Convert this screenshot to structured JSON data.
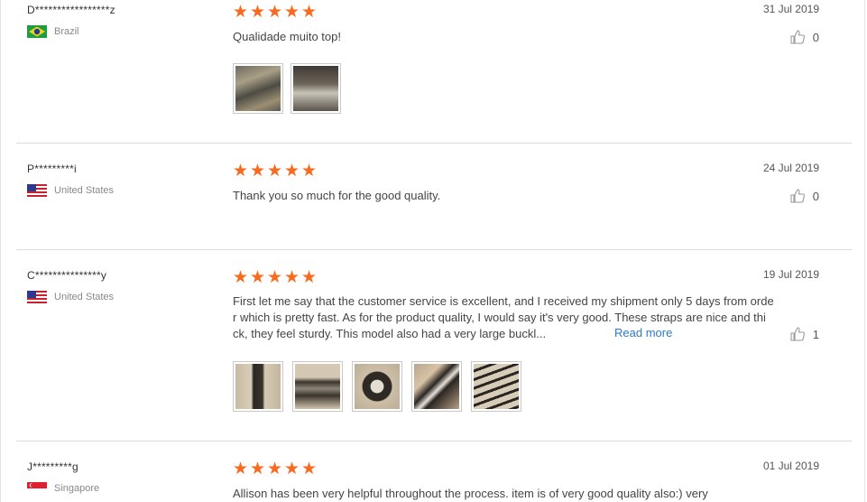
{
  "reviews": [
    {
      "name": "D*****************z",
      "country": "Brazil",
      "flag": "brazil-flag-icon",
      "rating": 5,
      "date": "31 Jul 2019",
      "text": "Qualidade muito top!",
      "likes": "0",
      "photos": 2
    },
    {
      "name": "P*********i",
      "country": "United States",
      "flag": "us-flag-icon",
      "rating": 5,
      "date": "24 Jul 2019",
      "text": "Thank you so much for the good quality.",
      "likes": "0",
      "photos": 0
    },
    {
      "name": "C***************y",
      "country": "United States",
      "flag": "us-flag-icon",
      "rating": 5,
      "date": "19 Jul 2019",
      "text_lines": [
        "First let me say that the customer service is excellent, and I received my shipment only 5 days from orde",
        "r which is pretty fast. As for the product quality,  I would say it's very good. These straps are nice and thi",
        "ck, they feel sturdy.  This model also had a very large buckl..."
      ],
      "read_more": "Read more",
      "likes": "1",
      "photos": 5
    },
    {
      "name": "J*********g",
      "country": "Singapore",
      "flag": "singapore-flag-icon",
      "rating": 5,
      "date": "01 Jul 2019",
      "text": "Allison has been very helpful throughout the process. item is of very good quality also:) very"
    }
  ],
  "colors": {
    "star": "#f86a1e",
    "link": "#2d7bc2",
    "separator": "#dcdcdc"
  }
}
